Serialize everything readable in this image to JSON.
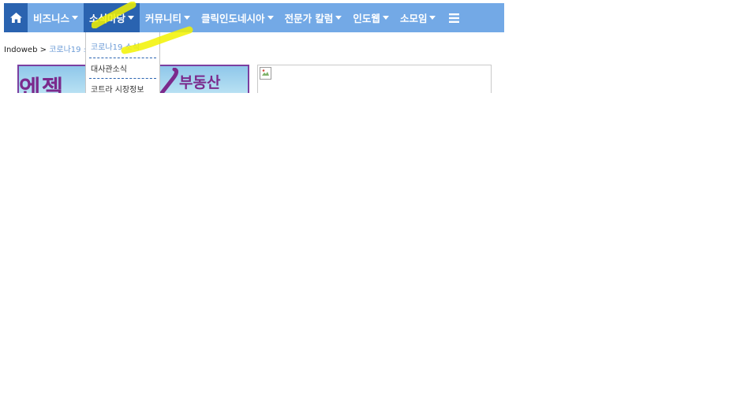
{
  "nav": {
    "home_icon": "home-icon",
    "items": [
      {
        "label": "비즈니스",
        "has_caret": true
      },
      {
        "label": "소식마당",
        "has_caret": true
      },
      {
        "label": "커뮤니티",
        "has_caret": true
      },
      {
        "label": "클릭인도네시아",
        "has_caret": true
      },
      {
        "label": "전문가 칼럼",
        "has_caret": true
      },
      {
        "label": "인도웹",
        "has_caret": true
      },
      {
        "label": "소모임",
        "has_caret": true
      }
    ],
    "menu_icon": "hamburger-menu-icon"
  },
  "dropdown": {
    "items": [
      "코로나19 소식",
      "대사관소식",
      "코트라 시장정보"
    ]
  },
  "breadcrumb": {
    "root": "Indoweb",
    "separator": ">",
    "current": "코로나19 소식"
  },
  "banner": {
    "text_left": "엔젤",
    "text_right": "부동산"
  },
  "colors": {
    "navbar_bg": "#73a9e6",
    "navbar_active": "#2a63b0",
    "link": "#6b9bd6",
    "highlight": "#f2f200"
  }
}
